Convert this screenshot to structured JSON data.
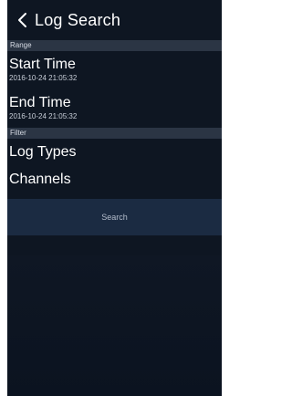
{
  "header": {
    "title": "Log Search",
    "back_icon": "chevron-left-icon"
  },
  "range": {
    "section_label": "Range",
    "start": {
      "label": "Start Time",
      "value": "2016-10-24 21:05:32"
    },
    "end": {
      "label": "End Time",
      "value": "2016-10-24 21:05:32"
    }
  },
  "filter": {
    "section_label": "Filter",
    "items": [
      {
        "label": "Log Types"
      },
      {
        "label": "Channels"
      }
    ]
  },
  "actions": {
    "search_label": "Search"
  },
  "colors": {
    "background": "#0e1622",
    "section_header": "#2b3544",
    "button": "#1b2b42",
    "text": "#ffffff"
  }
}
